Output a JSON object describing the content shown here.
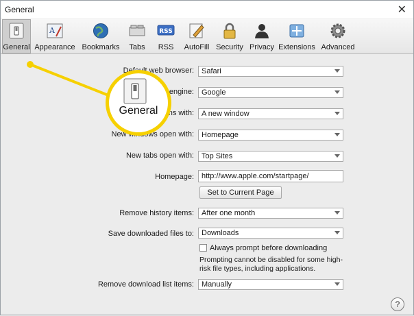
{
  "window": {
    "title": "General",
    "close_glyph": "✕"
  },
  "toolbar": {
    "items": [
      {
        "id": "general",
        "label": "General",
        "icon": "switch-icon",
        "active": true
      },
      {
        "id": "appearance",
        "label": "Appearance",
        "icon": "appearance-icon"
      },
      {
        "id": "bookmarks",
        "label": "Bookmarks",
        "icon": "globe-icon"
      },
      {
        "id": "tabs",
        "label": "Tabs",
        "icon": "tabs-icon"
      },
      {
        "id": "rss",
        "label": "RSS",
        "icon": "rss-icon",
        "icon_text": "RSS"
      },
      {
        "id": "autofill",
        "label": "AutoFill",
        "icon": "pen-icon"
      },
      {
        "id": "security",
        "label": "Security",
        "icon": "lock-icon"
      },
      {
        "id": "privacy",
        "label": "Privacy",
        "icon": "person-icon"
      },
      {
        "id": "extensions",
        "label": "Extensions",
        "icon": "puzzle-icon"
      },
      {
        "id": "advanced",
        "label": "Advanced",
        "icon": "gear-icon"
      }
    ]
  },
  "settings": {
    "default_browser": {
      "label": "Default web browser:",
      "value": "Safari"
    },
    "search_engine": {
      "label": "Default search engine:",
      "value": "Google"
    },
    "safari_opens": {
      "label": "Safari opens with:",
      "value": "A new window"
    },
    "new_windows": {
      "label": "New windows open with:",
      "value": "Homepage"
    },
    "new_tabs": {
      "label": "New tabs open with:",
      "value": "Top Sites"
    },
    "homepage": {
      "label": "Homepage:",
      "value": "http://www.apple.com/startpage/"
    },
    "set_current_page": "Set to Current Page",
    "remove_history": {
      "label": "Remove history items:",
      "value": "After one month"
    },
    "save_downloads": {
      "label": "Save downloaded files to:",
      "value": "Downloads"
    },
    "always_prompt": "Always prompt before downloading",
    "prompt_note": "Prompting cannot be disabled for some high-risk file types, including applications.",
    "remove_download_list": {
      "label": "Remove download list items:",
      "value": "Manually"
    }
  },
  "help_glyph": "?",
  "callout": {
    "label": "General",
    "icon": "switch-icon",
    "color": "#f6d000"
  }
}
